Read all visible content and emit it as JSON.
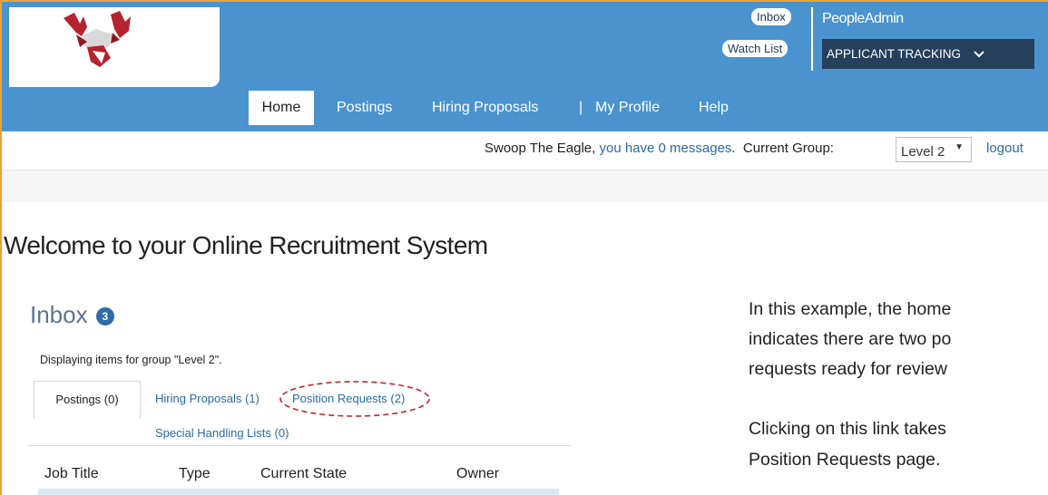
{
  "header": {
    "inbox_label": "Inbox",
    "watchlist_label": "Watch List",
    "brand": "PeopleAdmin",
    "app_select": "APPLICANT TRACKING"
  },
  "nav": {
    "home": "Home",
    "postings": "Postings",
    "hiring": "Hiring Proposals",
    "separator": "|",
    "profile": "My Profile",
    "help": "Help"
  },
  "userbar": {
    "greeting": "Swoop The Eagle, ",
    "messages": "you have 0 messages",
    "period": ".",
    "group_label": "Current Group:",
    "group_value": "Level 2",
    "logout": "logout"
  },
  "main": {
    "welcome": "Welcome to your Online Recruitment System",
    "inbox_title": "Inbox",
    "inbox_count": "3",
    "displaying": "Displaying items for group \"Level 2\".",
    "tabs": [
      "Postings (0)",
      "Hiring Proposals (1)",
      "Position Requests (2)",
      "Special Handling Lists (0)"
    ],
    "columns": [
      "Job Title",
      "Type",
      "Current State",
      "Owner"
    ]
  },
  "notes": {
    "line1": "In this example, the home",
    "line2": "indicates there are two po",
    "line3": "requests ready for review",
    "line4": "Clicking on this link takes",
    "line5": "Position Requests page."
  },
  "colors": {
    "header_blue": "#4a93cf",
    "app_select_bg": "#263f5c",
    "link_blue": "#2a6aa8",
    "annotation_red": "#c0272d",
    "badge_blue": "#2f6da6"
  }
}
